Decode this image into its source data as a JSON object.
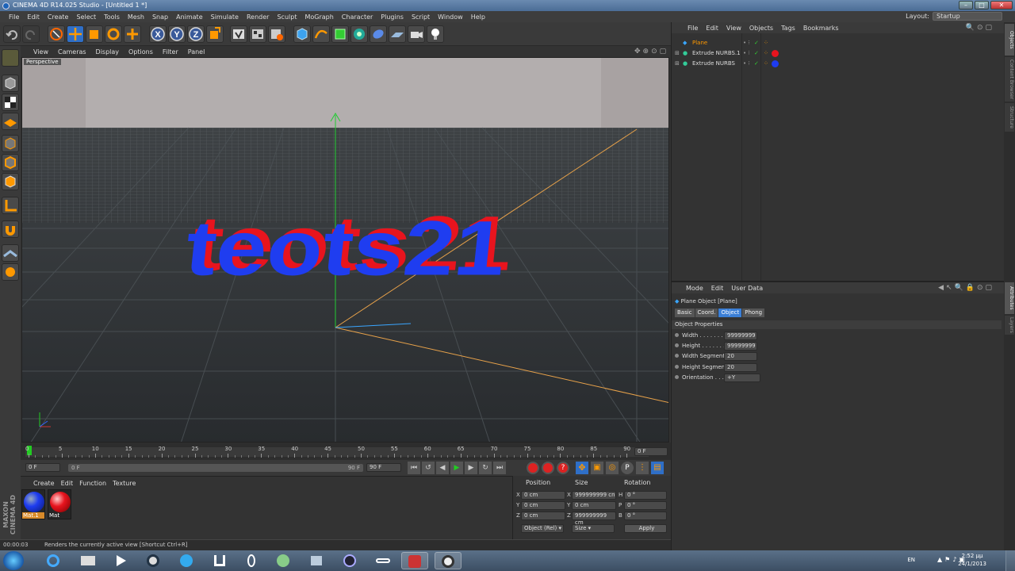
{
  "window": {
    "title": "CINEMA 4D R14.025 Studio - [Untitled 1 *]",
    "controls": [
      "minimize",
      "maximize",
      "close"
    ]
  },
  "menubar": {
    "items": [
      "File",
      "Edit",
      "Create",
      "Select",
      "Tools",
      "Mesh",
      "Snap",
      "Animate",
      "Simulate",
      "Render",
      "Sculpt",
      "MoGraph",
      "Character",
      "Plugins",
      "Script",
      "Window",
      "Help"
    ],
    "layout_label": "Layout:",
    "layout_value": "Startup"
  },
  "toolbar": {
    "icons": [
      "undo-icon",
      "redo-icon",
      "live-selection-icon",
      "move-icon",
      "scale-icon",
      "rotate-icon",
      "add-icon",
      "x-axis-lock-icon",
      "y-axis-lock-icon",
      "z-axis-lock-icon",
      "coordinate-system-icon",
      "render-view-icon",
      "render-picture-viewer-icon",
      "render-settings-icon",
      "cube-icon",
      "spline-pen-icon",
      "subdivision-icon",
      "array-icon",
      "deformer-icon",
      "floor-icon",
      "camera-icon",
      "light-icon"
    ],
    "axis_labels": [
      "X",
      "Y",
      "Z"
    ]
  },
  "viewport": {
    "menu": [
      "View",
      "Cameras",
      "Display",
      "Options",
      "Filter",
      "Panel"
    ],
    "camera_label": "Perspective",
    "scene_text": "teots21",
    "colors": {
      "sky": "#a8a2a2",
      "floor": "#2a2e30",
      "text_front": "#1f3df0",
      "text_back": "#e8141e",
      "axis_y": "#22cc33",
      "axis_line": "#e8a24a"
    }
  },
  "timeline": {
    "ticks": [
      "0",
      "5",
      "10",
      "15",
      "20",
      "25",
      "30",
      "35",
      "40",
      "45",
      "50",
      "55",
      "60",
      "65",
      "70",
      "75",
      "80",
      "85",
      "90"
    ],
    "current_frame": "0 F",
    "start_field": "0 F",
    "slider_start": "0 F",
    "slider_end": "90 F",
    "end_field": "90 F"
  },
  "materials": {
    "menu": [
      "Create",
      "Edit",
      "Function",
      "Texture"
    ],
    "items": [
      {
        "name": "Mat.1",
        "color": "#1e3cf0"
      },
      {
        "name": "Mat",
        "color": "#e8141e"
      }
    ]
  },
  "brand": {
    "line1": "MAXON",
    "line2": "CINEMA 4D"
  },
  "coords": {
    "headers": [
      "Position",
      "Size",
      "Rotation"
    ],
    "rows": [
      {
        "axis": "X",
        "pos": "0 cm",
        "size_axis": "X",
        "size": "999999999 cn",
        "rot_axis": "H",
        "rot": "0 °"
      },
      {
        "axis": "Y",
        "pos": "0 cm",
        "size_axis": "Y",
        "size": "0 cm",
        "rot_axis": "P",
        "rot": "0 °"
      },
      {
        "axis": "Z",
        "pos": "0 cm",
        "size_axis": "Z",
        "size": "999999999 cm",
        "rot_axis": "B",
        "rot": "0 °"
      }
    ],
    "mode_select": "Object (Rel)",
    "size_select": "Size",
    "apply_label": "Apply"
  },
  "statusbar": {
    "time": "00:00:03",
    "message": "Renders the currently active view [Shortcut Ctrl+R]"
  },
  "object_manager": {
    "menu": [
      "File",
      "Edit",
      "View",
      "Objects",
      "Tags",
      "Bookmarks"
    ],
    "objects": [
      {
        "name": "Plane",
        "selected": true,
        "tag_color": ""
      },
      {
        "name": "Extrude NURBS.1",
        "selected": false,
        "tag_color": "#e8141e"
      },
      {
        "name": "Extrude NURBS",
        "selected": false,
        "tag_color": "#1e3cf0"
      }
    ]
  },
  "attribute_manager": {
    "menu": [
      "Mode",
      "Edit",
      "User Data"
    ],
    "object_title": "Plane Object [Plane]",
    "tabs": [
      "Basic",
      "Coord.",
      "Object",
      "Phong"
    ],
    "active_tab": "Object",
    "section": "Object Properties",
    "properties": [
      {
        "label": "Width . . . . . . . . .",
        "value": "99999999"
      },
      {
        "label": "Height . . . . . . . . .",
        "value": "99999999"
      },
      {
        "label": "Width Segments",
        "value": "20"
      },
      {
        "label": "Height Segments",
        "value": "20"
      },
      {
        "label": "Orientation . . . .",
        "value": "+Y"
      }
    ]
  },
  "side_tabs": {
    "top": [
      "Objects",
      "Content Browser",
      "Structure"
    ],
    "bottom": [
      "Attributes",
      "Layers"
    ]
  },
  "taskbar": {
    "language": "EN",
    "time": "2:52 μμ",
    "date": "24/1/2013",
    "apps": [
      "start-orb-icon",
      "internet-explorer-icon",
      "file-explorer-icon",
      "media-player-icon",
      "app-icon-4",
      "app-icon-5",
      "app-icon-6",
      "app-icon-7",
      "app-icon-8",
      "app-icon-9",
      "app-icon-10",
      "app-icon-11",
      "app-icon-12",
      "cinema4d-icon"
    ]
  }
}
